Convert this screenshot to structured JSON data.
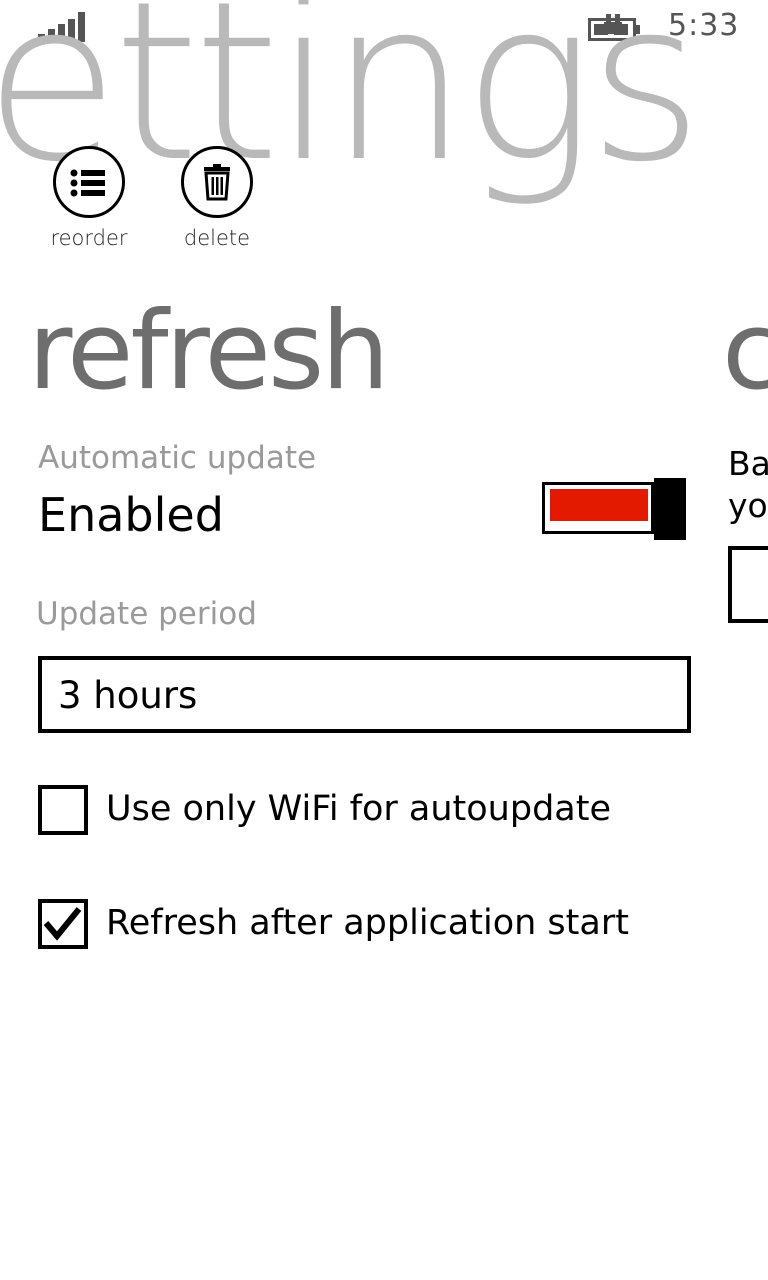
{
  "status_bar": {
    "time": "5:33",
    "signal_icon": "signal-strength-icon",
    "battery_icon": "battery-charging-icon"
  },
  "pivot": {
    "title": "ettings",
    "current_header": "refresh",
    "next_header_peek": "c"
  },
  "app_bar": {
    "buttons": [
      {
        "label": "reorder",
        "icon": "list-icon"
      },
      {
        "label": "delete",
        "icon": "trash-icon"
      }
    ]
  },
  "refresh_panel": {
    "automatic_update": {
      "label": "Automatic update",
      "value_text": "Enabled",
      "enabled": true,
      "accent_color": "#e31a00"
    },
    "update_period": {
      "label": "Update period",
      "selected": "3 hours"
    },
    "checkboxes": [
      {
        "label": "Use only WiFi for autoupdate",
        "checked": false
      },
      {
        "label": "Refresh after application start",
        "checked": true
      }
    ]
  },
  "next_panel_peek": {
    "line1": "Bac",
    "line2": "yo"
  }
}
